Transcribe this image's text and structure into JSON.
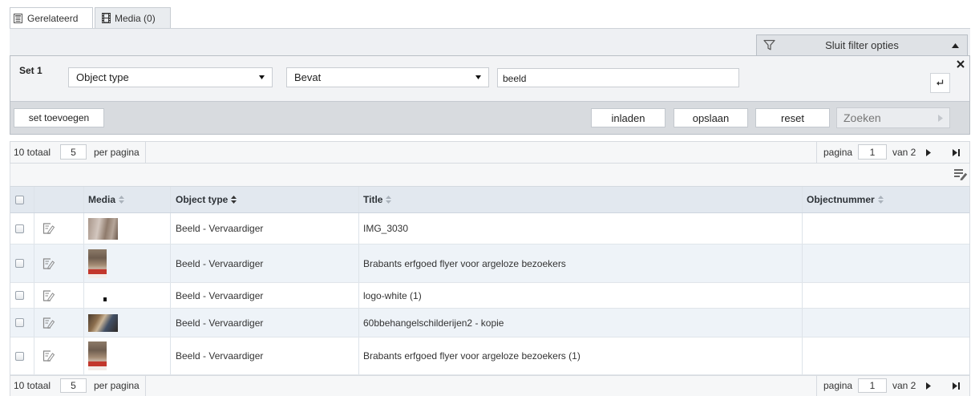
{
  "tabs": {
    "related": {
      "label": "Gerelateerd",
      "icon": "document-icon"
    },
    "media": {
      "label": "Media (0)",
      "icon": "film-icon"
    }
  },
  "filter_toggle": {
    "label": "Sluit filter opties",
    "icon": "funnel-icon",
    "arrow_icon": "chevron-up-icon"
  },
  "filter": {
    "set_label": "Set 1",
    "field": "Object type",
    "operator": "Bevat",
    "value": "beeld",
    "buttons": {
      "add_set": "set toevoegen",
      "load": "inladen",
      "save": "opslaan",
      "reset": "reset",
      "search": "Zoeken"
    }
  },
  "pager": {
    "total": "10 totaal",
    "page_size": "5",
    "per_page": "per pagina",
    "page_label": "pagina",
    "current_page": "1",
    "of_pages": "van 2"
  },
  "table": {
    "headers": {
      "media": {
        "label": "Media",
        "sort_icon": "sort-icon"
      },
      "object_type": {
        "label": "Object type",
        "sort_icon": "sort-active-icon"
      },
      "title": {
        "label": "Title",
        "sort_icon": "sort-icon"
      },
      "objectnummer": {
        "label": "Objectnummer",
        "sort_icon": "sort-icon"
      }
    },
    "rows": [
      {
        "object_type": "Beeld - Vervaardiger",
        "title": "IMG_3030"
      },
      {
        "object_type": "Beeld - Vervaardiger",
        "title": "Brabants erfgoed flyer voor argeloze bezoekers"
      },
      {
        "object_type": "Beeld - Vervaardiger",
        "title": "logo-white (1)"
      },
      {
        "object_type": "Beeld - Vervaardiger",
        "title": "60bbehangelschilderijen2 - kopie"
      },
      {
        "object_type": "Beeld - Vervaardiger",
        "title": "Brabants erfgoed flyer voor argeloze bezoekers (1)"
      }
    ]
  },
  "colors": {
    "table_header_bg": "#e2e8ef",
    "alt_row_bg": "#eef3f8",
    "filter_panel_bg": "#f2f3f5",
    "filter_actions_bg": "#d8dbdf"
  }
}
